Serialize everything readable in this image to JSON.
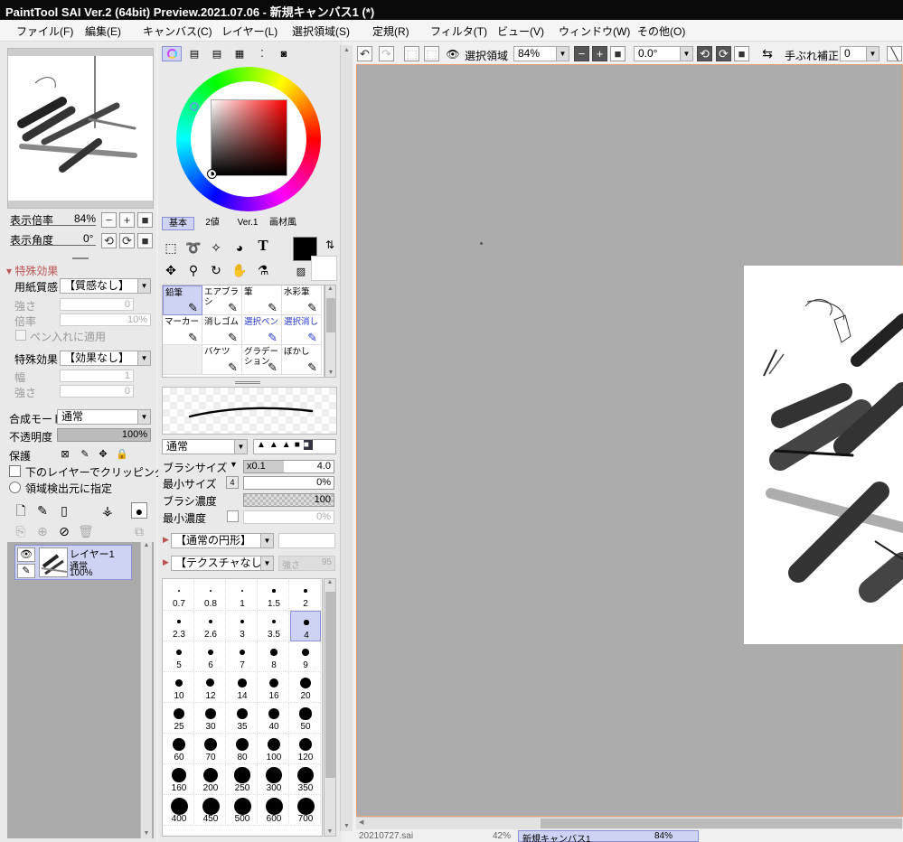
{
  "title": "PaintTool SAI Ver.2 (64bit) Preview.2021.07.06 - 新規キャンバス1 (*)",
  "menu": [
    "ファイル(F)",
    "編集(E)",
    "キャンバス(C)",
    "レイヤー(L)",
    "選択領域(S)",
    "定規(R)",
    "フィルタ(T)",
    "ビュー(V)",
    "ウィンドウ(W)",
    "その他(O)"
  ],
  "navigator": {
    "zoom_label": "表示倍率",
    "zoom_value": "84%",
    "angle_label": "表示角度",
    "angle_value": "0°"
  },
  "effects": {
    "header": "特殊効果",
    "paper_label": "用紙質感",
    "paper_value": "【質感なし】",
    "strength_label": "強さ",
    "strength_value": "0",
    "scale_label": "倍率",
    "scale_value": "10%",
    "pen_apply": "ペン入れに適用",
    "effect_label": "特殊効果",
    "effect_value": "【効果なし】",
    "width_label": "幅",
    "width_value": "1",
    "strength2_label": "強さ",
    "strength2_value": "0"
  },
  "layer_props": {
    "blend_label": "合成モード",
    "blend_value": "通常",
    "opacity_label": "不透明度",
    "opacity_value": "100%",
    "protect_label": "保護",
    "clip_label": "下のレイヤーでクリッピング",
    "source_label": "領域検出元に指定"
  },
  "layer": {
    "name": "レイヤー1",
    "mode": "通常",
    "opacity": "100%"
  },
  "color_tabs": [
    "基本",
    "2値",
    "Ver.1",
    "画材風"
  ],
  "tools": [
    {
      "label": "鉛筆",
      "active": true,
      "blue": false
    },
    {
      "label": "エアブラシ",
      "active": false,
      "blue": false
    },
    {
      "label": "筆",
      "active": false,
      "blue": false
    },
    {
      "label": "水彩筆",
      "active": false,
      "blue": false
    },
    {
      "label": "マーカー",
      "active": false,
      "blue": false
    },
    {
      "label": "消しゴム",
      "active": false,
      "blue": false
    },
    {
      "label": "選択ペン",
      "active": false,
      "blue": true
    },
    {
      "label": "選択消し",
      "active": false,
      "blue": true
    },
    {
      "label": "",
      "active": false,
      "blue": false
    },
    {
      "label": "バケツ",
      "active": false,
      "blue": false
    },
    {
      "label": "グラデーション",
      "active": false,
      "blue": false
    },
    {
      "label": "ぼかし",
      "active": false,
      "blue": false
    }
  ],
  "brush": {
    "mode_value": "通常",
    "size_label": "ブラシサイズ",
    "size_mult": "x0.1",
    "size_value": "4.0",
    "min_size_label": "最小サイズ",
    "min_size_value": "0%",
    "density_label": "ブラシ濃度",
    "density_value": "100",
    "min_density_label": "最小濃度",
    "min_density_value": "0%",
    "shape_value": "【通常の円形】",
    "texture_value": "【テクスチャなし】",
    "texture_strength_label": "強さ",
    "texture_strength_value": "95"
  },
  "sizes": [
    "0.7",
    "0.8",
    "1",
    "1.5",
    "2",
    "2.3",
    "2.6",
    "3",
    "3.5",
    "4",
    "5",
    "6",
    "7",
    "8",
    "9",
    "10",
    "12",
    "14",
    "16",
    "20",
    "25",
    "30",
    "35",
    "40",
    "50",
    "60",
    "70",
    "80",
    "100",
    "120",
    "160",
    "200",
    "250",
    "300",
    "350",
    "400",
    "450",
    "500",
    "600",
    "700"
  ],
  "selected_size": "4",
  "toolbar": {
    "select_label": "選択領域",
    "zoom_value": "84%",
    "angle_value": "0.0°",
    "stabilizer_label": "手ぶれ補正",
    "stabilizer_value": "0"
  },
  "status_tabs": [
    "20210727.sai",
    "新規キャンバス1"
  ],
  "status_zooms": [
    "42%",
    "84%"
  ],
  "colors": {
    "accent": "#8b8fd6",
    "current": "#000000"
  }
}
